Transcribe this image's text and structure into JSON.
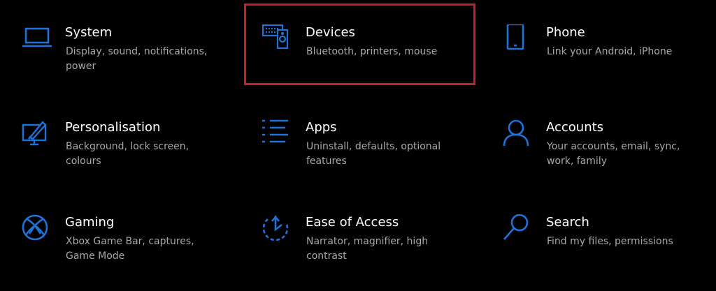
{
  "accent_color": "#1e72d9",
  "highlight_color": "#c8202a",
  "tiles": [
    {
      "title": "System",
      "description": "Display, sound, notifications, power",
      "icon": "laptop-icon"
    },
    {
      "title": "Devices",
      "description": "Bluetooth, printers, mouse",
      "icon": "devices-icon",
      "highlighted": true
    },
    {
      "title": "Phone",
      "description": "Link your Android, iPhone",
      "icon": "phone-icon"
    },
    {
      "title": "Personalisation",
      "description": "Background, lock screen, colours",
      "icon": "personalisation-icon"
    },
    {
      "title": "Apps",
      "description": "Uninstall, defaults, optional features",
      "icon": "apps-list-icon"
    },
    {
      "title": "Accounts",
      "description": "Your accounts, email, sync, work, family",
      "icon": "person-icon"
    },
    {
      "title": "Gaming",
      "description": "Xbox Game Bar, captures, Game Mode",
      "icon": "xbox-icon"
    },
    {
      "title": "Ease of Access",
      "description": "Narrator, magnifier, high contrast",
      "icon": "ease-of-access-icon"
    },
    {
      "title": "Search",
      "description": "Find my files, permissions",
      "icon": "search-icon"
    }
  ]
}
